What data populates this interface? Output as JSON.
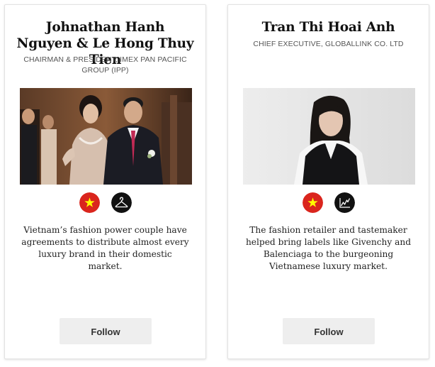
{
  "profiles": [
    {
      "name": "Johnathan Hanh Nguyen & Le Hong Thuy Tien",
      "title": "CHAIRMAN & PRESIDENT, IMEX PAN PACIFIC GROUP (IPP)",
      "photo_icon": "couple-photo",
      "icons": [
        "vietnam-flag-icon",
        "hanger-icon"
      ],
      "description": "Vietnam’s fashion power couple have agreements to distribute almost every luxury brand in their domestic market.",
      "follow_label": "Follow"
    },
    {
      "name": "Tran Thi Hoai Anh",
      "title": "CHIEF EXECUTIVE, GLOBALLINK CO. LTD",
      "photo_icon": "portrait-photo",
      "icons": [
        "vietnam-flag-icon",
        "trend-chart-icon"
      ],
      "description": "The fashion retailer and tastemaker helped bring labels like Givenchy and Balenciaga to the burgeoning Vietnamese luxury market.",
      "follow_label": "Follow"
    }
  ],
  "colors": {
    "flag_red": "#da251d",
    "flag_star": "#ffff00",
    "icon_dark": "#111111",
    "button_bg": "#eeeeee"
  }
}
